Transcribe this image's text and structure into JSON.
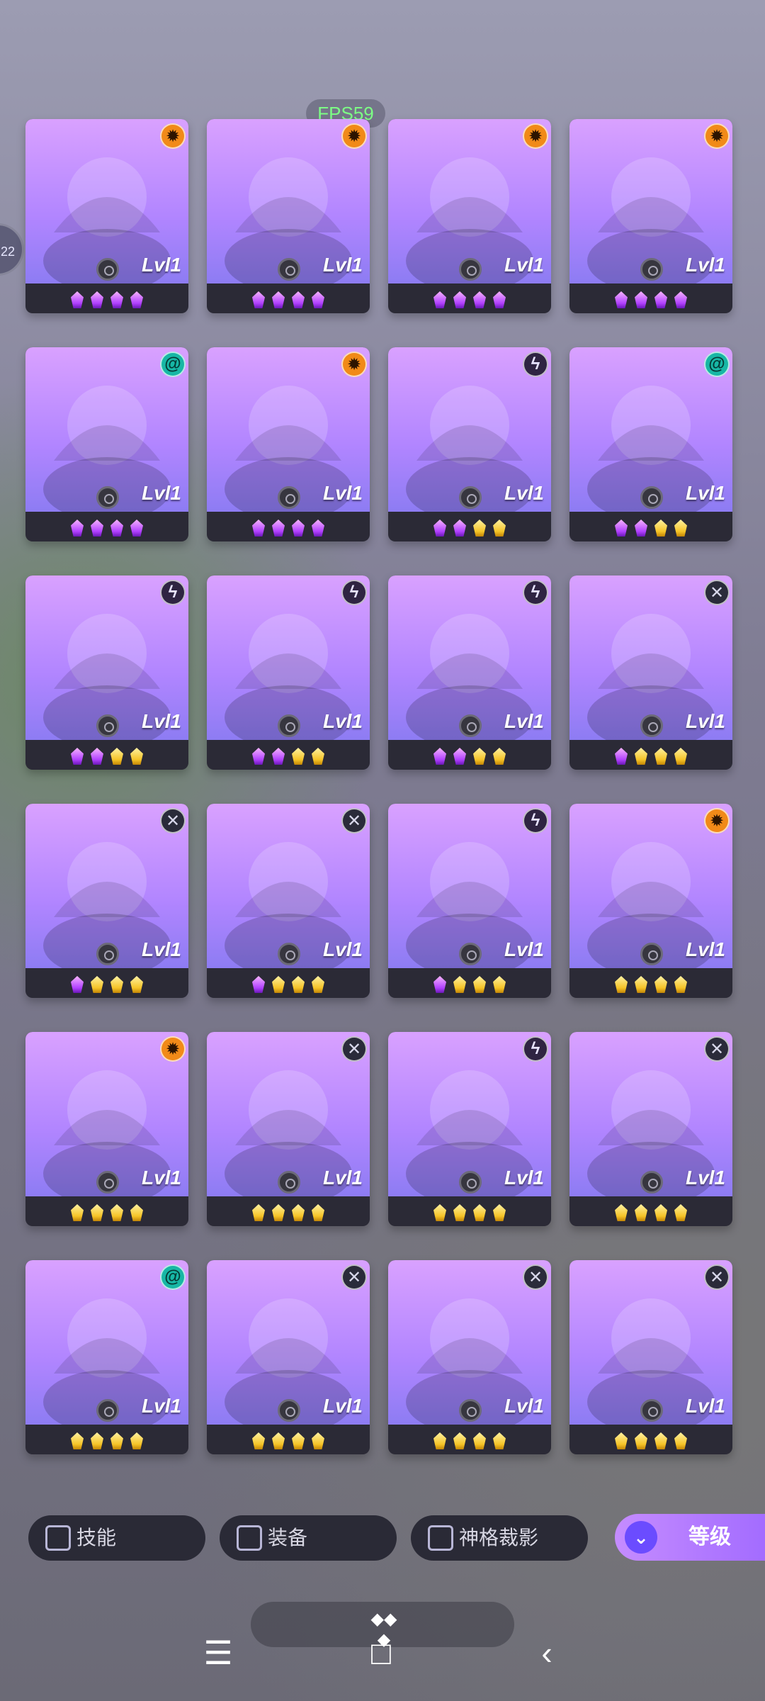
{
  "status": {
    "fps": "FPS59",
    "side_handle": "22"
  },
  "cards": [
    {
      "row": 1,
      "col": 1,
      "level": "Lvl1",
      "element_icon": "sun-element-icon",
      "gems": [
        "p",
        "p",
        "p",
        "p"
      ]
    },
    {
      "row": 1,
      "col": 2,
      "level": "Lvl1",
      "element_icon": "sun-element-icon",
      "gems": [
        "p",
        "p",
        "p",
        "p"
      ]
    },
    {
      "row": 1,
      "col": 3,
      "level": "Lvl1",
      "element_icon": "sun-element-icon",
      "gems": [
        "p",
        "p",
        "p",
        "p"
      ]
    },
    {
      "row": 1,
      "col": 4,
      "level": "Lvl1",
      "element_icon": "sun-element-icon",
      "gems": [
        "p",
        "p",
        "p",
        "p"
      ]
    },
    {
      "row": 2,
      "col": 1,
      "level": "Lvl1",
      "element_icon": "spiral-element-icon",
      "gems": [
        "p",
        "p",
        "p",
        "p"
      ]
    },
    {
      "row": 2,
      "col": 2,
      "level": "Lvl1",
      "element_icon": "sun-element-icon",
      "gems": [
        "p",
        "p",
        "p",
        "p"
      ]
    },
    {
      "row": 2,
      "col": 3,
      "level": "Lvl1",
      "element_icon": "bolt-element-icon",
      "gems": [
        "p",
        "p",
        "y",
        "y"
      ]
    },
    {
      "row": 2,
      "col": 4,
      "level": "Lvl1",
      "element_icon": "spiral-element-icon",
      "gems": [
        "p",
        "p",
        "y",
        "y"
      ]
    },
    {
      "row": 3,
      "col": 1,
      "level": "Lvl1",
      "element_icon": "bolt-element-icon",
      "gems": [
        "p",
        "p",
        "y",
        "y"
      ]
    },
    {
      "row": 3,
      "col": 2,
      "level": "Lvl1",
      "element_icon": "bolt-element-icon",
      "gems": [
        "p",
        "p",
        "y",
        "y"
      ]
    },
    {
      "row": 3,
      "col": 3,
      "level": "Lvl1",
      "element_icon": "bolt-element-icon",
      "gems": [
        "p",
        "p",
        "y",
        "y"
      ]
    },
    {
      "row": 3,
      "col": 4,
      "level": "Lvl1",
      "element_icon": "cross-element-icon",
      "gems": [
        "p",
        "y",
        "y",
        "y"
      ]
    },
    {
      "row": 4,
      "col": 1,
      "level": "Lvl1",
      "element_icon": "cross-element-icon",
      "gems": [
        "p",
        "y",
        "y",
        "y"
      ]
    },
    {
      "row": 4,
      "col": 2,
      "level": "Lvl1",
      "element_icon": "cross-element-icon",
      "gems": [
        "p",
        "y",
        "y",
        "y"
      ]
    },
    {
      "row": 4,
      "col": 3,
      "level": "Lvl1",
      "element_icon": "bolt-element-icon",
      "gems": [
        "p",
        "y",
        "y",
        "y"
      ]
    },
    {
      "row": 4,
      "col": 4,
      "level": "Lvl1",
      "element_icon": "sun-element-icon",
      "gems": [
        "y",
        "y",
        "y",
        "y"
      ]
    },
    {
      "row": 5,
      "col": 1,
      "level": "Lvl1",
      "element_icon": "sun-element-icon",
      "gems": [
        "y",
        "y",
        "y",
        "y"
      ]
    },
    {
      "row": 5,
      "col": 2,
      "level": "Lvl1",
      "element_icon": "cross-element-icon",
      "gems": [
        "y",
        "y",
        "y",
        "y"
      ]
    },
    {
      "row": 5,
      "col": 3,
      "level": "Lvl1",
      "element_icon": "bolt-element-icon",
      "gems": [
        "y",
        "y",
        "y",
        "y"
      ]
    },
    {
      "row": 5,
      "col": 4,
      "level": "Lvl1",
      "element_icon": "cross-element-icon",
      "gems": [
        "y",
        "y",
        "y",
        "y"
      ]
    },
    {
      "row": 6,
      "col": 1,
      "level": "Lvl1",
      "element_icon": "spiral-element-icon",
      "gems": [
        "y",
        "y",
        "y",
        "y"
      ]
    },
    {
      "row": 6,
      "col": 2,
      "level": "Lvl1",
      "element_icon": "cross-element-icon",
      "gems": [
        "y",
        "y",
        "y",
        "y"
      ]
    },
    {
      "row": 6,
      "col": 3,
      "level": "Lvl1",
      "element_icon": "cross-element-icon",
      "gems": [
        "y",
        "y",
        "y",
        "y"
      ]
    },
    {
      "row": 6,
      "col": 4,
      "level": "Lvl1",
      "element_icon": "cross-element-icon",
      "gems": [
        "y",
        "y",
        "y",
        "y"
      ]
    }
  ],
  "filters": [
    {
      "label": "技能"
    },
    {
      "label": "装备"
    },
    {
      "label": "神格裁影"
    }
  ],
  "sort_button": {
    "label": "等级"
  },
  "nav": {
    "menu_icon": "☰",
    "home_icon": "□",
    "back_icon": "‹"
  }
}
